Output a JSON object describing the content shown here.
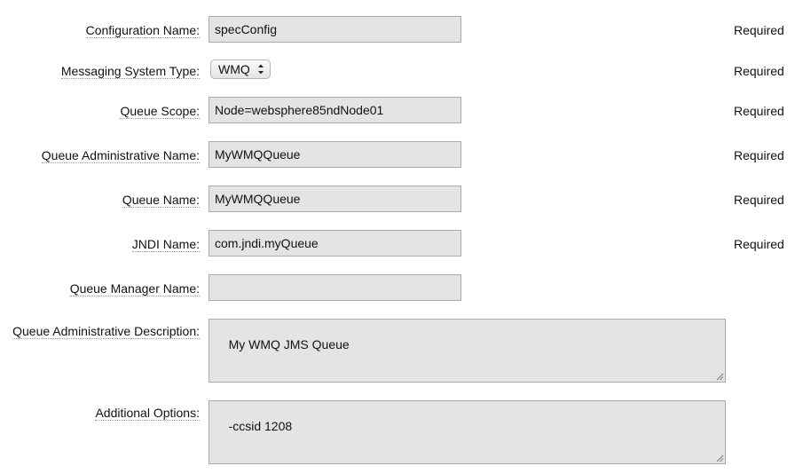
{
  "form": {
    "configuration_name": {
      "label": "Configuration Name:",
      "value": "specConfig",
      "required": "Required"
    },
    "messaging_system_type": {
      "label": "Messaging System Type:",
      "selected": "WMQ",
      "required": "Required"
    },
    "queue_scope": {
      "label": "Queue Scope:",
      "value": "Node=websphere85ndNode01",
      "required": "Required"
    },
    "queue_admin_name": {
      "label": "Queue Administrative Name:",
      "value": "MyWMQQueue",
      "required": "Required"
    },
    "queue_name": {
      "label": "Queue Name:",
      "value": "MyWMQQueue",
      "required": "Required"
    },
    "jndi_name": {
      "label": "JNDI Name:",
      "value": "com.jndi.myQueue",
      "required": "Required"
    },
    "queue_manager_name": {
      "label": "Queue Manager Name:",
      "value": ""
    },
    "queue_admin_description": {
      "label": "Queue Administrative Description:",
      "value": "My WMQ JMS Queue"
    },
    "additional_options": {
      "label": "Additional Options:",
      "value": "-ccsid 1208"
    }
  },
  "icons": {
    "select_arrows": "up-down-chevron-icon",
    "resize_grip": "resize-grip-icon"
  },
  "colors": {
    "field_background": "#e4e4e4",
    "field_border": "#a9a9a9"
  }
}
